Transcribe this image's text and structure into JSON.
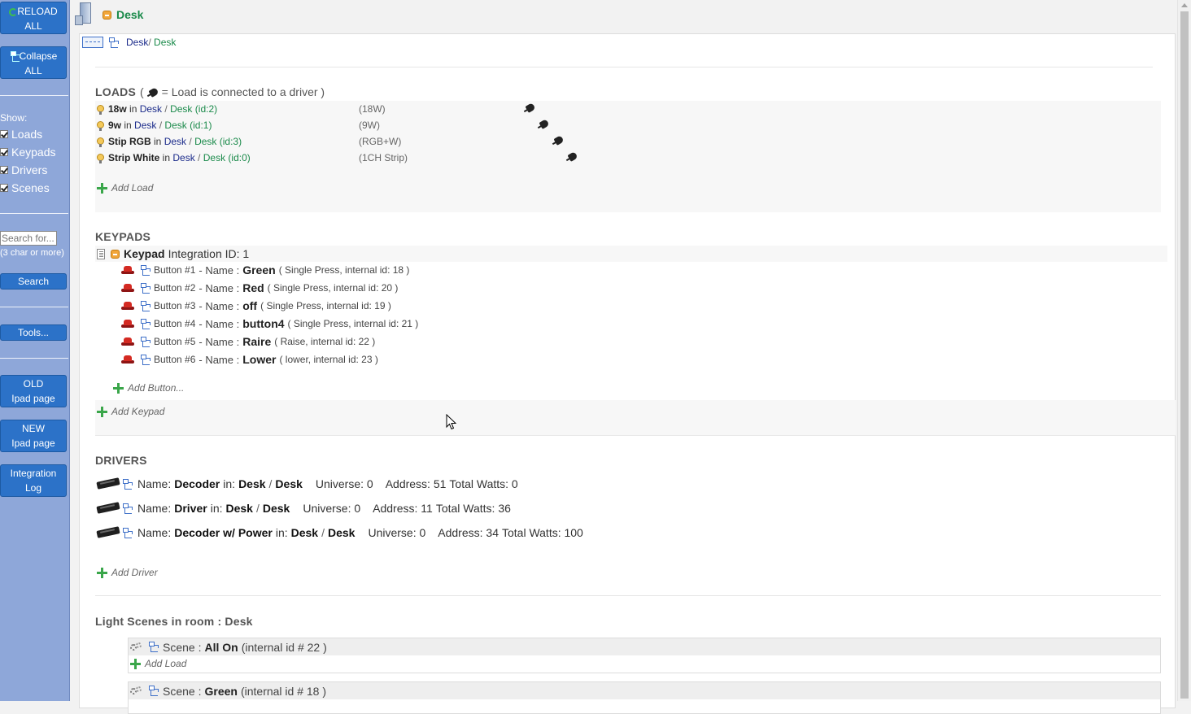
{
  "sidebar": {
    "reload_line1": "RELOAD",
    "reload_line2": "ALL",
    "collapse_line1": "Collapse",
    "collapse_line2": "ALL",
    "show_label": "Show:",
    "show_items": [
      "Loads",
      "Keypads",
      "Drivers",
      "Scenes"
    ],
    "search_placeholder": "Search for...",
    "search_hint": "(3 char or more)",
    "search_button": "Search",
    "tools_button": "Tools...",
    "old_ipad_line1": "OLD",
    "old_ipad_line2": "Ipad page",
    "new_ipad_line1": "NEW",
    "new_ipad_line2": "Ipad page",
    "log_line1": "Integration",
    "log_line2": "Log"
  },
  "header": {
    "title": "Desk"
  },
  "breadcrumb": {
    "parent": "Desk",
    "sep": "/",
    "current": "Desk"
  },
  "loads": {
    "title": "LOADS",
    "legend_prefix": "(",
    "legend_text": "= Load is connected to a driver )",
    "items": [
      {
        "name": "18w",
        "in": "in",
        "area": "Desk",
        "sep": "/",
        "room": "Desk",
        "id": "(id:2)",
        "type": "(18W)"
      },
      {
        "name": "9w",
        "in": "in",
        "area": "Desk",
        "sep": "/",
        "room": "Desk",
        "id": "(id:1)",
        "type": "(9W)"
      },
      {
        "name": "Stip RGB",
        "in": "in",
        "area": "Desk",
        "sep": "/",
        "room": "Desk",
        "id": "(id:3)",
        "type": "(RGB+W)"
      },
      {
        "name": "Strip White",
        "in": "in",
        "area": "Desk",
        "sep": "/",
        "room": "Desk",
        "id": "(id:0)",
        "type": "(1CH Strip)"
      }
    ],
    "add_label": "Add Load"
  },
  "keypads": {
    "title": "KEYPADS",
    "keypad_label": "Keypad",
    "integration_label": "Integration ID: 1",
    "buttons": [
      {
        "num": "Button #1",
        "name_label": "- Name :",
        "name": "Green",
        "detail": "( Single Press, internal id: 18 )"
      },
      {
        "num": "Button #2",
        "name_label": "- Name :",
        "name": "Red",
        "detail": "( Single Press, internal id: 20 )"
      },
      {
        "num": "Button #3",
        "name_label": "- Name :",
        "name": "off",
        "detail": "( Single Press, internal id: 19 )"
      },
      {
        "num": "Button #4",
        "name_label": "- Name :",
        "name": "button4",
        "detail": "( Single Press, internal id: 21 )"
      },
      {
        "num": "Button #5",
        "name_label": "- Name :",
        "name": "Raire",
        "detail": "( Raise, internal id: 22 )"
      },
      {
        "num": "Button #6",
        "name_label": "- Name :",
        "name": "Lower",
        "detail": "( lower, internal id: 23 )"
      }
    ],
    "add_button_label": "Add Button...",
    "add_keypad_label": "Add Keypad"
  },
  "drivers": {
    "title": "DRIVERS",
    "items": [
      {
        "name_label": "Name:",
        "name": "Decoder",
        "in": "in:",
        "area": "Desk",
        "sep": "/",
        "room": "Desk",
        "universe": "Universe: 0",
        "address": "Address: 51",
        "watts": "Total Watts: 0"
      },
      {
        "name_label": "Name:",
        "name": "Driver",
        "in": "in:",
        "area": "Desk",
        "sep": "/",
        "room": "Desk",
        "universe": "Universe: 0",
        "address": "Address: 11",
        "watts": "Total Watts: 36"
      },
      {
        "name_label": "Name:",
        "name": "Decoder w/ Power",
        "in": "in:",
        "area": "Desk",
        "sep": "/",
        "room": "Desk",
        "universe": "Universe: 0",
        "address": "Address: 34",
        "watts": "Total Watts: 100"
      }
    ],
    "add_label": "Add Driver"
  },
  "scenes": {
    "title": "Light Scenes in room : Desk",
    "items": [
      {
        "prefix": "Scene :",
        "name": "All On",
        "detail": "(internal id # 22 )",
        "add_label": "Add Load"
      },
      {
        "prefix": "Scene :",
        "name": "Green",
        "detail": "(internal id # 18 )"
      }
    ]
  },
  "colors": {
    "navy": "#1a2a8a",
    "green": "#1a8a4a",
    "sidebar_bg": "#8ea7d9",
    "button_blue": "#2c72c8"
  }
}
